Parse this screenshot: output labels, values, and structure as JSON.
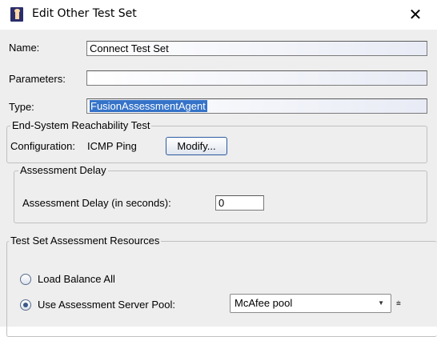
{
  "window": {
    "title": "Edit Other Test Set",
    "close_symbol": "✕"
  },
  "form": {
    "name_label": "Name:",
    "name_value": "Connect Test Set",
    "parameters_label": "Parameters:",
    "parameters_value": "",
    "type_label": "Type:",
    "type_value": "FusionAssessmentAgent"
  },
  "reachability": {
    "title": "End-System Reachability Test",
    "config_label": "Configuration:",
    "config_value": "ICMP Ping",
    "modify_label": "Modify..."
  },
  "delay": {
    "title": "Assessment Delay",
    "field_label": "Assessment Delay (in seconds):",
    "field_value": "0"
  },
  "resources": {
    "title": "Test Set Assessment Resources",
    "option_load_balance": "Load Balance All",
    "option_pool": "Use Assessment Server Pool:",
    "selected_option": "pool",
    "pool_value": "McAfee pool",
    "dropdown_arrow": "▼",
    "filter_symbol": "⩧"
  },
  "colors": {
    "selection": "#3573c8",
    "app_icon": "#2b2e6b"
  }
}
